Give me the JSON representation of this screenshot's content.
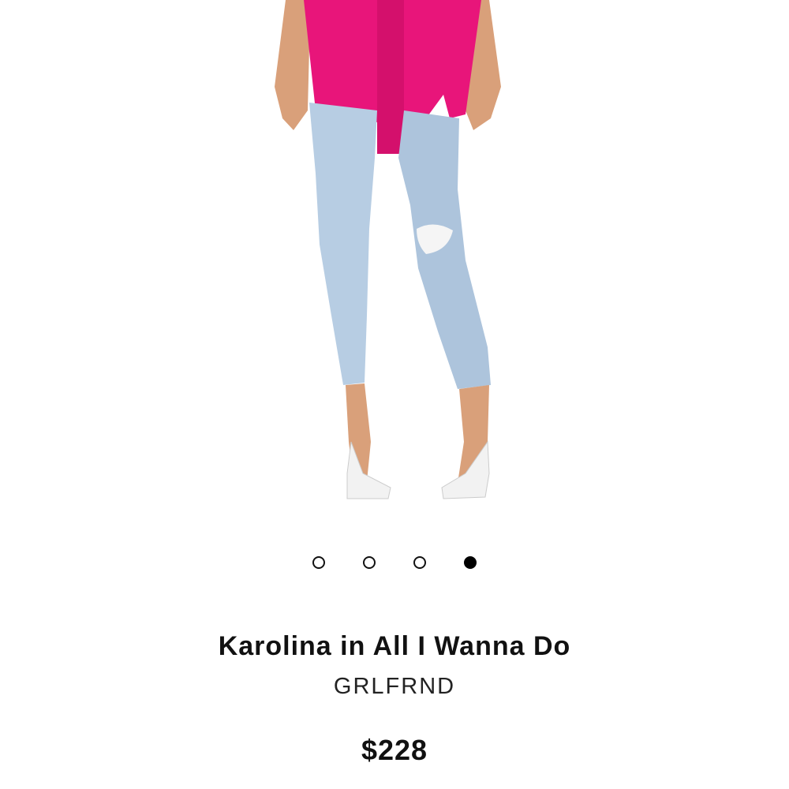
{
  "product": {
    "image_alt": "Model wearing light wash distressed cropped jeans with pink knit top and white heels",
    "title": "Karolina in All I Wanna Do",
    "brand": "GRLFRND",
    "price": "$228"
  },
  "carousel": {
    "total": 4,
    "active_index": 3
  },
  "colors": {
    "top_pink": "#e8157a",
    "denim": "#b7cde3",
    "skin": "#d9a07a",
    "shoe_white": "#f2f2f2",
    "dot_active": "#000000"
  }
}
